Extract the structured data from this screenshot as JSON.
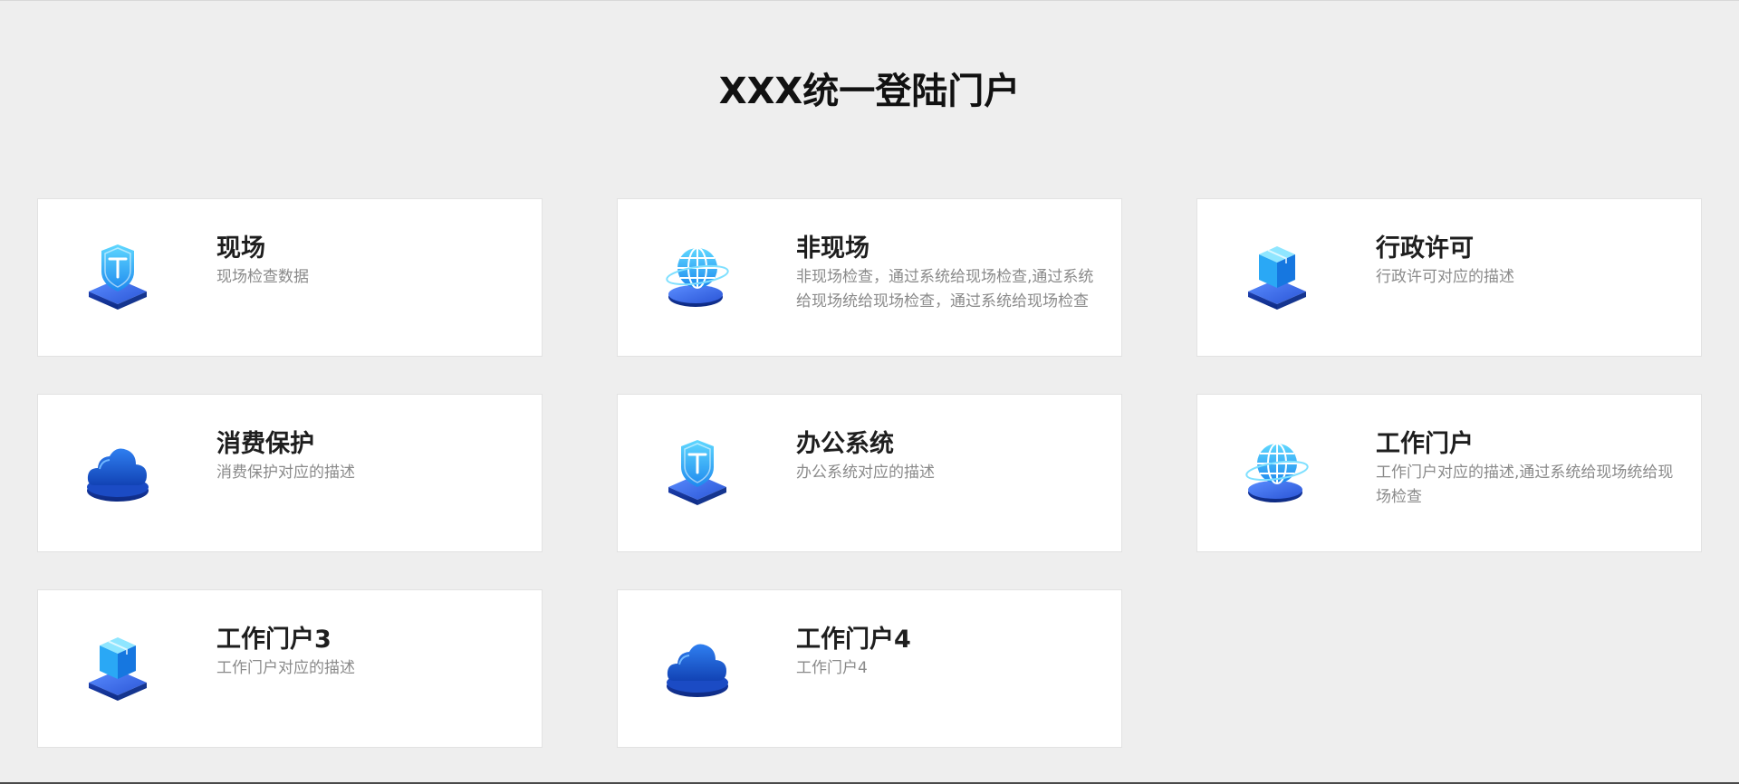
{
  "page": {
    "title": "XXX统一登陆门户"
  },
  "colors": {
    "background": "#eeeeee",
    "card": "#ffffff",
    "title_text": "#1e1e1e",
    "desc_text": "#8a8a8a",
    "icon_light_blue": "#36c6ff",
    "icon_deep_blue": "#1d57d8"
  },
  "cards": [
    {
      "title": "现场",
      "desc": "现场检查数据",
      "icon": "shield-icon"
    },
    {
      "title": "非现场",
      "desc": "非现场检查，通过系统给现场检查,通过系统给现场统给现场检查，通过系统给现场检查",
      "icon": "globe-icon"
    },
    {
      "title": "行政许可",
      "desc": "行政许可对应的描述",
      "icon": "cube-icon"
    },
    {
      "title": "消费保护",
      "desc": "消费保护对应的描述",
      "icon": "cloud-icon"
    },
    {
      "title": "办公系统",
      "desc": "办公系统对应的描述",
      "icon": "shield-icon"
    },
    {
      "title": "工作门户",
      "desc": "工作门户对应的描述,通过系统给现场统给现场检查",
      "icon": "globe-icon"
    },
    {
      "title": "工作门户3",
      "desc": "工作门户对应的描述",
      "icon": "cube-icon"
    },
    {
      "title": "工作门户4",
      "desc": "工作门户4",
      "icon": "cloud-icon"
    }
  ]
}
